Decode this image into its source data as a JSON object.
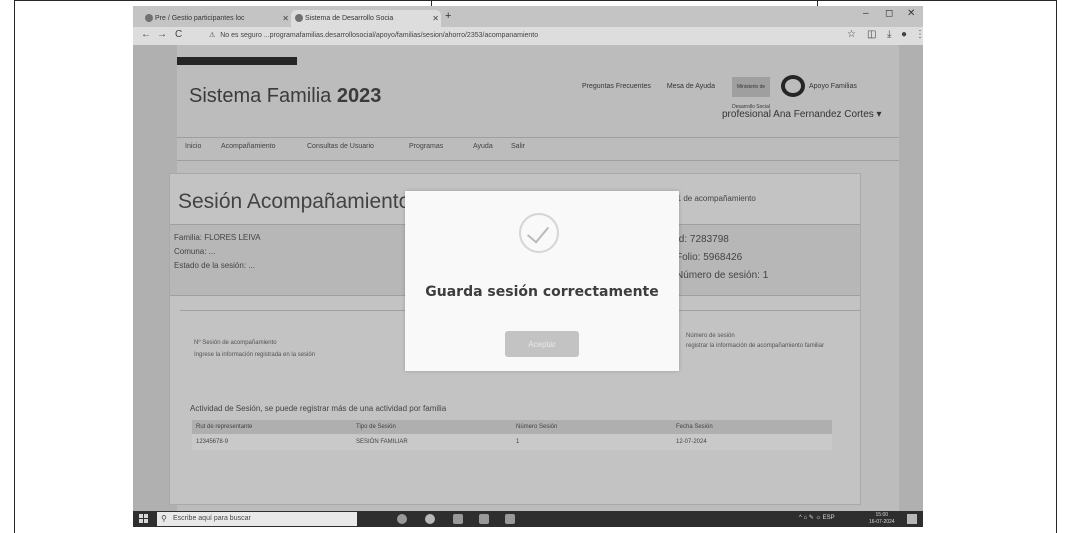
{
  "browser": {
    "tabs": [
      {
        "label": "Pre / Gestio participantes loc"
      },
      {
        "label": "Sistema de Desarrollo Socia"
      }
    ],
    "new_tab": "+",
    "window_controls": {
      "minimize": "–",
      "maximize": "◻",
      "close": "✕"
    },
    "nav": {
      "back": "←",
      "forward": "→",
      "reload": "C"
    },
    "url_security": "No es seguro",
    "url": "...programafamilias.desarrollosocial/apoyo/familias/sesion/ahorro/2353/acompanamiento"
  },
  "app": {
    "title_prefix": "Sistema Familia",
    "title_year": "2023",
    "header_links": [
      "Preguntas Frecuentes",
      "Mesa de Ayuda"
    ],
    "brand_box": "Ministerio de Desarrollo Social",
    "brand_name": "Apoyo Familias",
    "user_menu": "profesional Ana Fernandez Cortes ▾",
    "menu": [
      "Inicio",
      "Acompañamiento",
      "Consultas de Usuario",
      "Programas",
      "Ayuda",
      "Salir"
    ]
  },
  "content": {
    "section_title": "Sesión Acompañamiento",
    "section_note": "Sesión 1 de acompañamiento",
    "info_left": [
      "Familia: FLORES LEIVA",
      "Comuna: ...",
      "Estado de la sesión: ..."
    ],
    "info_right": [
      "Id: 7283798",
      "Folio: 5968426",
      "Número de sesión: 1"
    ],
    "block_left": [
      "Nº Sesión de acompañamiento",
      "Ingrese la información registrada en la sesión"
    ],
    "block_right": [
      "Número de sesión",
      "registrar la información de acompañamiento familiar"
    ],
    "table_heading": "Actividad de Sesión, se puede registrar más de una actividad por familia",
    "table_headers": [
      "Rut de representante",
      "Tipo de Sesión",
      "Número Sesión",
      "Fecha Sesión"
    ],
    "table_rows": [
      [
        "12345678-9",
        "SESIÓN FAMILIAR",
        "1",
        "12-07-2024"
      ]
    ]
  },
  "modal": {
    "message": "Guarda sesión correctamente",
    "button": "Aceptar"
  },
  "taskbar": {
    "search_placeholder": "Escribe aquí para buscar",
    "tray": "^ ⌂ ✎ ☼ ESP",
    "time": "15:00",
    "date": "16-07-2024"
  }
}
